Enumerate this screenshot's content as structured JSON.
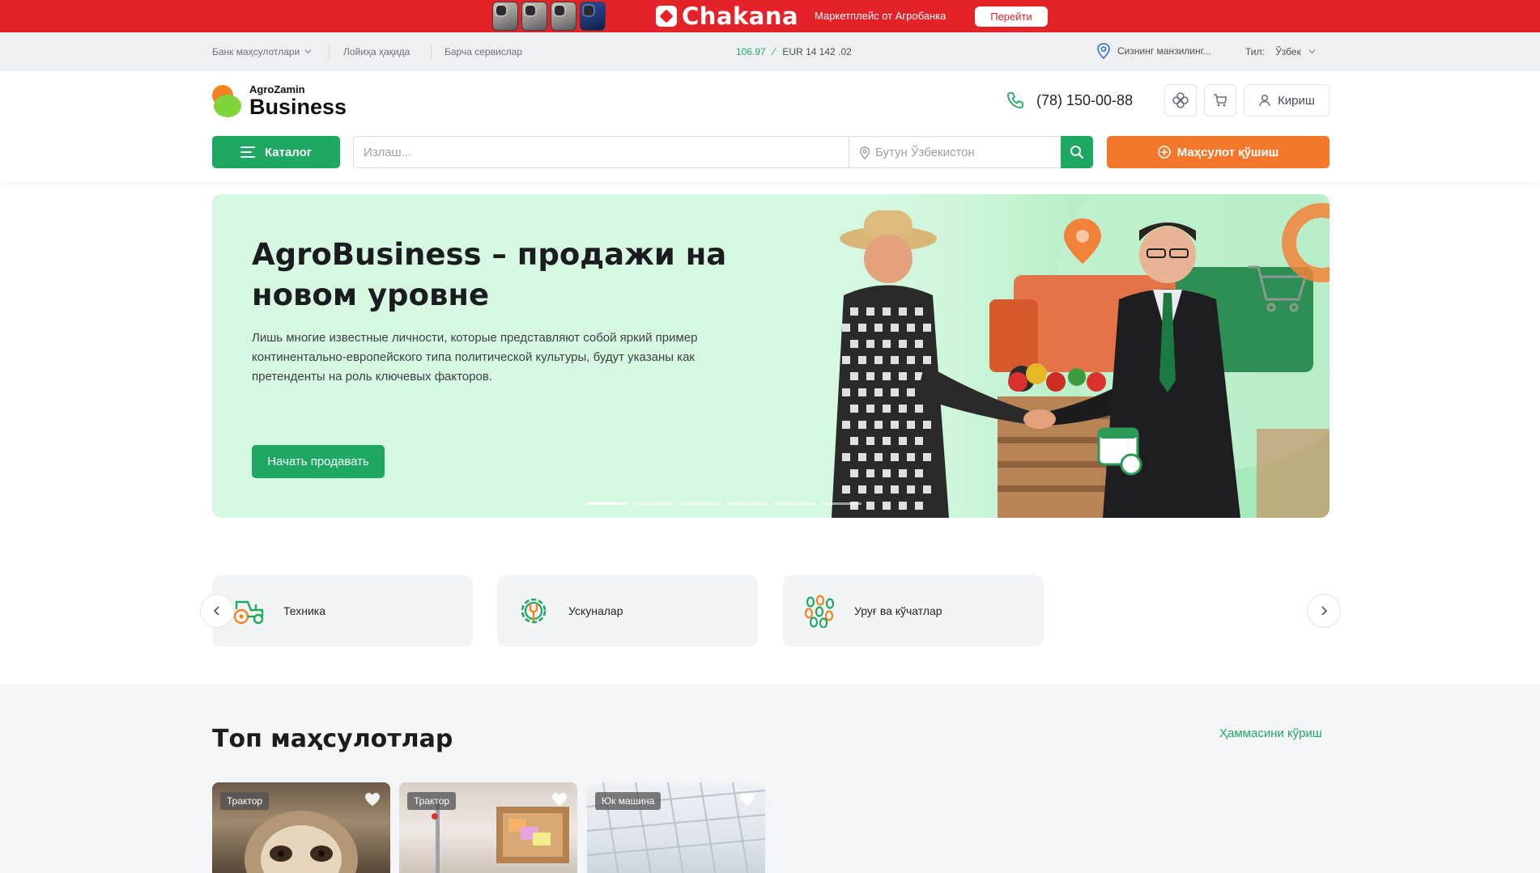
{
  "promo": {
    "brand": "Chakana",
    "subtitle": "Маркетплейс от Агробанка",
    "button": "Перейти"
  },
  "util": {
    "links": [
      "Банк маҳсулотлари",
      "Лойиҳа ҳақида",
      "Барча сервислар"
    ],
    "rates": {
      "usd": "106.97",
      "eur": "EUR 14 142 .02"
    },
    "location": "Сизнинг манзилинг...",
    "lang_label": "Тил:",
    "lang_value": "Ўзбек"
  },
  "header": {
    "logo_top": "AgroZamin",
    "logo_bottom": "Business",
    "phone": "(78) 150-00-88",
    "login": "Кириш",
    "catalog": "Каталог",
    "search_placeholder": "Излаш...",
    "region": "Бутун Ўзбекистон",
    "add_product": "Маҳсулот қўшиш"
  },
  "hero": {
    "title": "AgroBusiness – продажи на новом уровне",
    "text": "Лишь многие известные личности, которые представляют собой яркий пример континентально-европейского типа политической культуры, будут указаны как претенденты на роль ключевых факторов.",
    "cta": "Начать продавать",
    "slides": 6,
    "active_slide": 1
  },
  "categories": [
    {
      "label": "Техника",
      "icon": "tractor-icon"
    },
    {
      "label": "Ускуналар",
      "icon": "gear-wrench-icon"
    },
    {
      "label": "Уруғ ва кўчатлар",
      "icon": "seeds-icon"
    }
  ],
  "top_products": {
    "title": "Топ маҳсулотлар",
    "see_all": "Ҳаммасини кўриш",
    "items": [
      {
        "tag": "Трактор"
      },
      {
        "tag": "Трактор"
      },
      {
        "tag": "Юк машина"
      }
    ]
  },
  "colors": {
    "brand_green": "#1fa862",
    "accent_orange": "#f5772c",
    "promo_red": "#e32229",
    "hero_bg": "#d6f8e1"
  }
}
